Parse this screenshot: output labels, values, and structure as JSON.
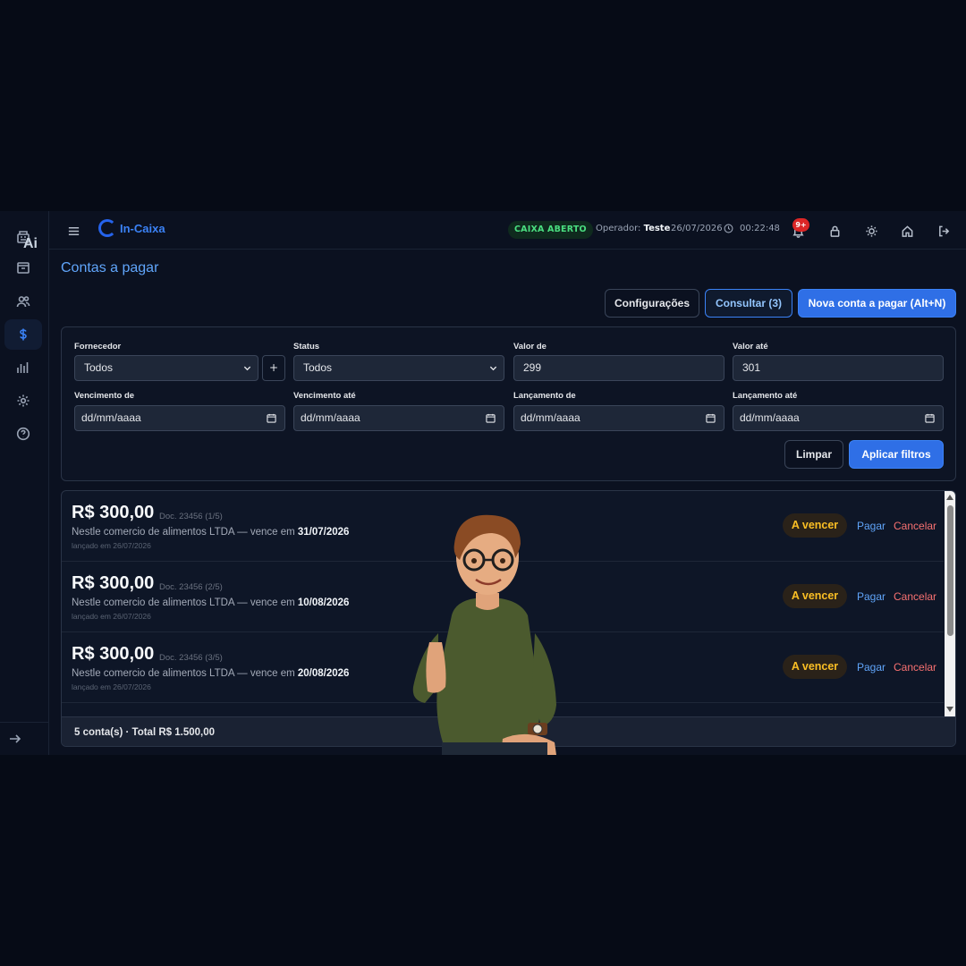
{
  "topbar": {
    "brand": "In-Caixa",
    "caixa_status": "CAIXA ABERTO",
    "operator_label": "Operador:",
    "operator_name": "Teste",
    "date": "26/07/2026",
    "time": "00:22:48",
    "notifications": "9+"
  },
  "sidebar": {
    "ai_label": "Ai"
  },
  "page": {
    "title": "Contas a pagar"
  },
  "toolbar": {
    "config_label": "Configurações",
    "consult_label": "Consultar (3)",
    "new_label": "Nova conta a pagar (Alt+N)"
  },
  "filters": {
    "fornecedor_label": "Fornecedor",
    "fornecedor_value": "Todos",
    "add_label": "+",
    "status_label": "Status",
    "status_value": "Todos",
    "valor_de_label": "Valor de",
    "valor_de_value": "299",
    "valor_ate_label": "Valor até",
    "valor_ate_value": "301",
    "venc_de_label": "Vencimento de",
    "venc_ate_label": "Vencimento até",
    "lanc_de_label": "Lançamento de",
    "lanc_ate_label": "Lançamento até",
    "date_placeholder": "dd/mm/aaaa",
    "clear_label": "Limpar",
    "apply_label": "Aplicar filtros"
  },
  "rows": [
    {
      "amount": "R$ 300,00",
      "doc": "Doc. 23456 (1/5)",
      "desc": "Nestle comercio de alimentos LTDA — vence em ",
      "due": "31/07/2026",
      "launched": "lançado em 26/07/2026",
      "status": "A vencer",
      "pay": "Pagar",
      "cancel": "Cancelar"
    },
    {
      "amount": "R$ 300,00",
      "doc": "Doc. 23456 (2/5)",
      "desc": "Nestle comercio de alimentos LTDA — vence em ",
      "due": "10/08/2026",
      "launched": "lançado em 26/07/2026",
      "status": "A vencer",
      "pay": "Pagar",
      "cancel": "Cancelar"
    },
    {
      "amount": "R$ 300,00",
      "doc": "Doc. 23456 (3/5)",
      "desc": "Nestle comercio de alimentos LTDA — vence em ",
      "due": "20/08/2026",
      "launched": "lançado em 26/07/2026",
      "status": "A vencer",
      "pay": "Pagar",
      "cancel": "Cancelar"
    }
  ],
  "summary": {
    "text": "5 conta(s) · Total R$ 1.500,00"
  },
  "colors": {
    "accent": "#3b82f6",
    "status_warning": "#fbbf24",
    "status_open": "#4ade80",
    "danger": "#f87171"
  }
}
